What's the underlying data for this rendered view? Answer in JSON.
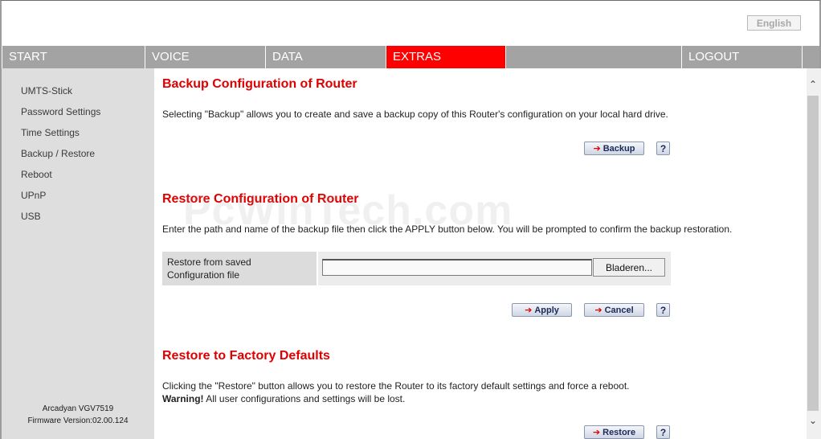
{
  "header": {
    "language_button": "English"
  },
  "topnav": {
    "items": [
      {
        "label": "START"
      },
      {
        "label": "VOICE"
      },
      {
        "label": "DATA"
      },
      {
        "label": "EXTRAS"
      },
      {
        "label": ""
      },
      {
        "label": "LOGOUT"
      }
    ],
    "active_color": "#ff0000"
  },
  "sidebar": {
    "items": [
      {
        "label": "UMTS-Stick"
      },
      {
        "label": "Password Settings"
      },
      {
        "label": "Time Settings"
      },
      {
        "label": "Backup / Restore"
      },
      {
        "label": "Reboot"
      },
      {
        "label": "UPnP"
      },
      {
        "label": "USB"
      }
    ],
    "footer_model": "Arcadyan VGV7519",
    "footer_firmware": "Firmware Version:02.00.124"
  },
  "main": {
    "backup": {
      "title": "Backup Configuration of Router",
      "description": "Selecting \"Backup\" allows you to create and save a backup copy of this Router's configuration on your local hard drive.",
      "button": "Backup",
      "help": "?"
    },
    "restore": {
      "title": "Restore Configuration of Router",
      "description": "Enter the path and name of the backup file then click the APPLY button below. You will be prompted to confirm the backup restoration.",
      "file_label_line1": "Restore from saved",
      "file_label_line2": "Configuration file",
      "file_value": "",
      "browse_button": "Bladeren...",
      "apply_button": "Apply",
      "cancel_button": "Cancel",
      "help": "?"
    },
    "factory": {
      "title": "Restore to Factory Defaults",
      "description": "Clicking the \"Restore\" button allows you to restore the Router to its factory default settings and force a reboot.",
      "warning_label": "Warning!",
      "warning_text": " All user configurations and settings will be lost.",
      "button": "Restore",
      "help": "?"
    }
  },
  "watermark": "PcWinTech.com",
  "colors": {
    "accent": "#ff0000",
    "title_red": "#e00000",
    "nav_gray": "#a3a3a3",
    "sidebar_bg": "#dedede"
  }
}
